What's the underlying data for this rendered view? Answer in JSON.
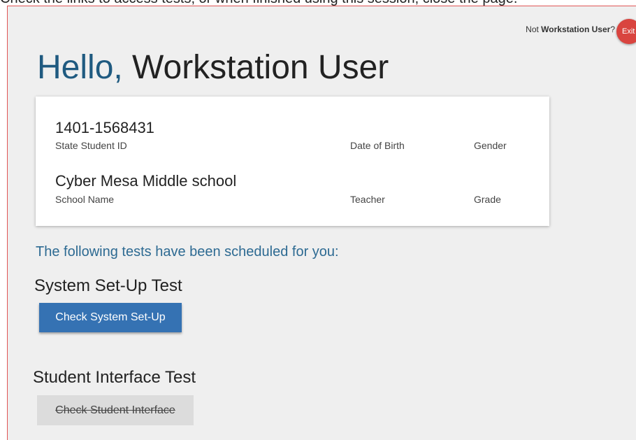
{
  "top_note": "Check the links to access tests, or when finished using this session, close the page.",
  "header": {
    "not_prefix": "Not ",
    "user_name": "Workstation User",
    "not_suffix": "?",
    "exit_label": "Exit"
  },
  "greeting": {
    "hello": "Hello,",
    "name": " Workstation User"
  },
  "student_card": {
    "student_id": "1401-1568431",
    "student_id_label": "State Student ID",
    "dob_label": "Date of Birth",
    "gender_label": "Gender",
    "school_name": "Cyber Mesa Middle school",
    "school_name_label": "School Name",
    "teacher_label": "Teacher",
    "grade_label": "Grade"
  },
  "scheduled_heading": "The following tests have been scheduled for you:",
  "tests": [
    {
      "title": "System Set-Up Test",
      "button_label": "Check System Set-Up",
      "enabled": true
    },
    {
      "title": "Student Interface Test",
      "button_label": "Check Student Interface",
      "enabled": false
    }
  ],
  "colors": {
    "accent": "#1f5a80",
    "primary_button": "#3572b3",
    "exit_button": "#d9443f",
    "frame_border": "#e05555"
  }
}
